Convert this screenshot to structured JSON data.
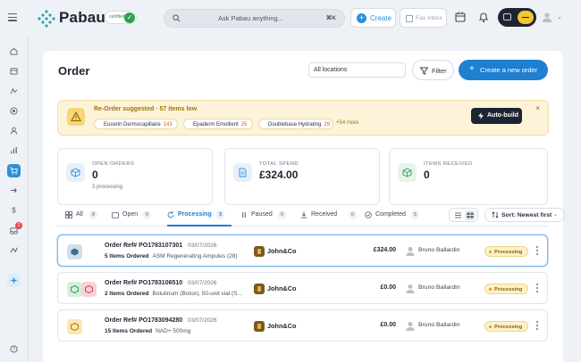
{
  "app": {
    "brand": "Pabau",
    "cert_label": "certified"
  },
  "search": {
    "placeholder": "Ask Pabau anything...",
    "shortcut": "⌘K"
  },
  "header": {
    "create_label": "Create",
    "fax_label": "Fax Inbox"
  },
  "sidebar": {
    "items": [
      {
        "icon": "home-icon"
      },
      {
        "icon": "calendar-icon"
      },
      {
        "icon": "contacts-icon"
      },
      {
        "icon": "target-icon"
      },
      {
        "icon": "user-icon"
      },
      {
        "icon": "chart-icon"
      },
      {
        "icon": "cart-icon",
        "active": true
      },
      {
        "icon": "forward-icon"
      },
      {
        "icon": "dollar-icon"
      },
      {
        "icon": "inbox-icon",
        "badge": "2"
      },
      {
        "icon": "flow-icon"
      },
      {
        "icon": "sparkle-icon"
      }
    ],
    "help_icon": "help-icon"
  },
  "page": {
    "title": "Order",
    "location_value": "All locations",
    "filter_label": "Filter",
    "new_order_label": "Create a new order"
  },
  "banner": {
    "title": "Re-Order suggested · 57 items low",
    "chips": [
      {
        "name": "Eucerin Dermocapillaire",
        "count": "143"
      },
      {
        "name": "Epaderm Emollient",
        "count": "25"
      },
      {
        "name": "Doublebase Hydrating",
        "count": "29"
      }
    ],
    "more": "+54 more",
    "autobuild_label": "Auto-build",
    "close": "×"
  },
  "stats": [
    {
      "label": "OPEN ORDERS",
      "value": "0",
      "sub": "3 processing",
      "color": "#2f8fd6",
      "bg": "#e7f1fb"
    },
    {
      "label": "TOTAL SPEND",
      "value": "£324.00",
      "sub": "",
      "color": "#2f8fd6",
      "bg": "#e7f1fb"
    },
    {
      "label": "ITEMS RECEIVED",
      "value": "0",
      "sub": "",
      "color": "#2f9e53",
      "bg": "#e6f4ea"
    }
  ],
  "tabs": [
    {
      "label": "All",
      "count": "8"
    },
    {
      "label": "Open",
      "count": "0"
    },
    {
      "label": "Processing",
      "count": "3",
      "active": true
    },
    {
      "label": "Paused",
      "count": "0"
    },
    {
      "label": "Received",
      "count": "0"
    },
    {
      "label": "Completed",
      "count": "5"
    }
  ],
  "sort": {
    "label": "Sort: Newest first"
  },
  "orders": [
    {
      "ref": "Order Ref# PO1783107301",
      "date": "03/07/2026",
      "items": "5 Items Ordered",
      "desc": "ASM Regenerating Ampules (28)",
      "supplier": "John&Co",
      "amount": "£324.00",
      "user": "Bruno Ballardin",
      "status": "Processing"
    },
    {
      "ref": "Order Ref# PO1783106510",
      "date": "03/07/2026",
      "items": "2 Items Ordered",
      "desc": "Botulinum (Botox), 50-unit vial (S...",
      "supplier": "John&Co",
      "amount": "£0.00",
      "user": "Bruno Ballardin",
      "status": "Processing"
    },
    {
      "ref": "Order Ref# PO1783094280",
      "date": "03/07/2026",
      "items": "15 Items Ordered",
      "desc": "NAD+ 500mg",
      "supplier": "John&Co",
      "amount": "£0.00",
      "user": "Bruno Ballardin",
      "status": "Processing"
    }
  ]
}
